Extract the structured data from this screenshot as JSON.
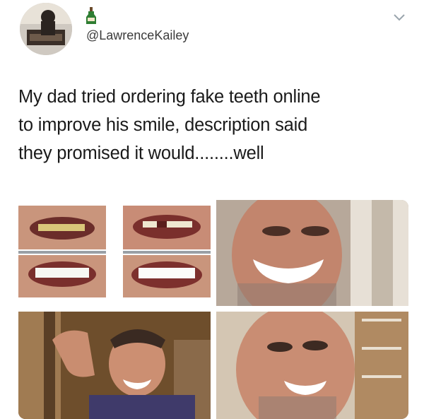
{
  "tweet": {
    "handle": "@LawrenceKailey",
    "text": "My dad tried ordering fake teeth online\nto improve his smile, description said\nthey promised it would........well"
  },
  "icons": {
    "avatar": "profile-photo",
    "badge": "bottle-emoji-icon",
    "menu": "chevron-down-icon"
  },
  "media": {
    "photos": [
      {
        "name": "before-after-teeth-product-photo"
      },
      {
        "name": "selfie-smiling-with-fake-teeth-1"
      },
      {
        "name": "selfie-smiling-with-fake-teeth-2"
      },
      {
        "name": "selfie-smiling-with-fake-teeth-3"
      }
    ]
  },
  "colors": {
    "text": "#1a1a1a",
    "handle": "#3b3b3b",
    "chevron": "#9aa5ad"
  }
}
